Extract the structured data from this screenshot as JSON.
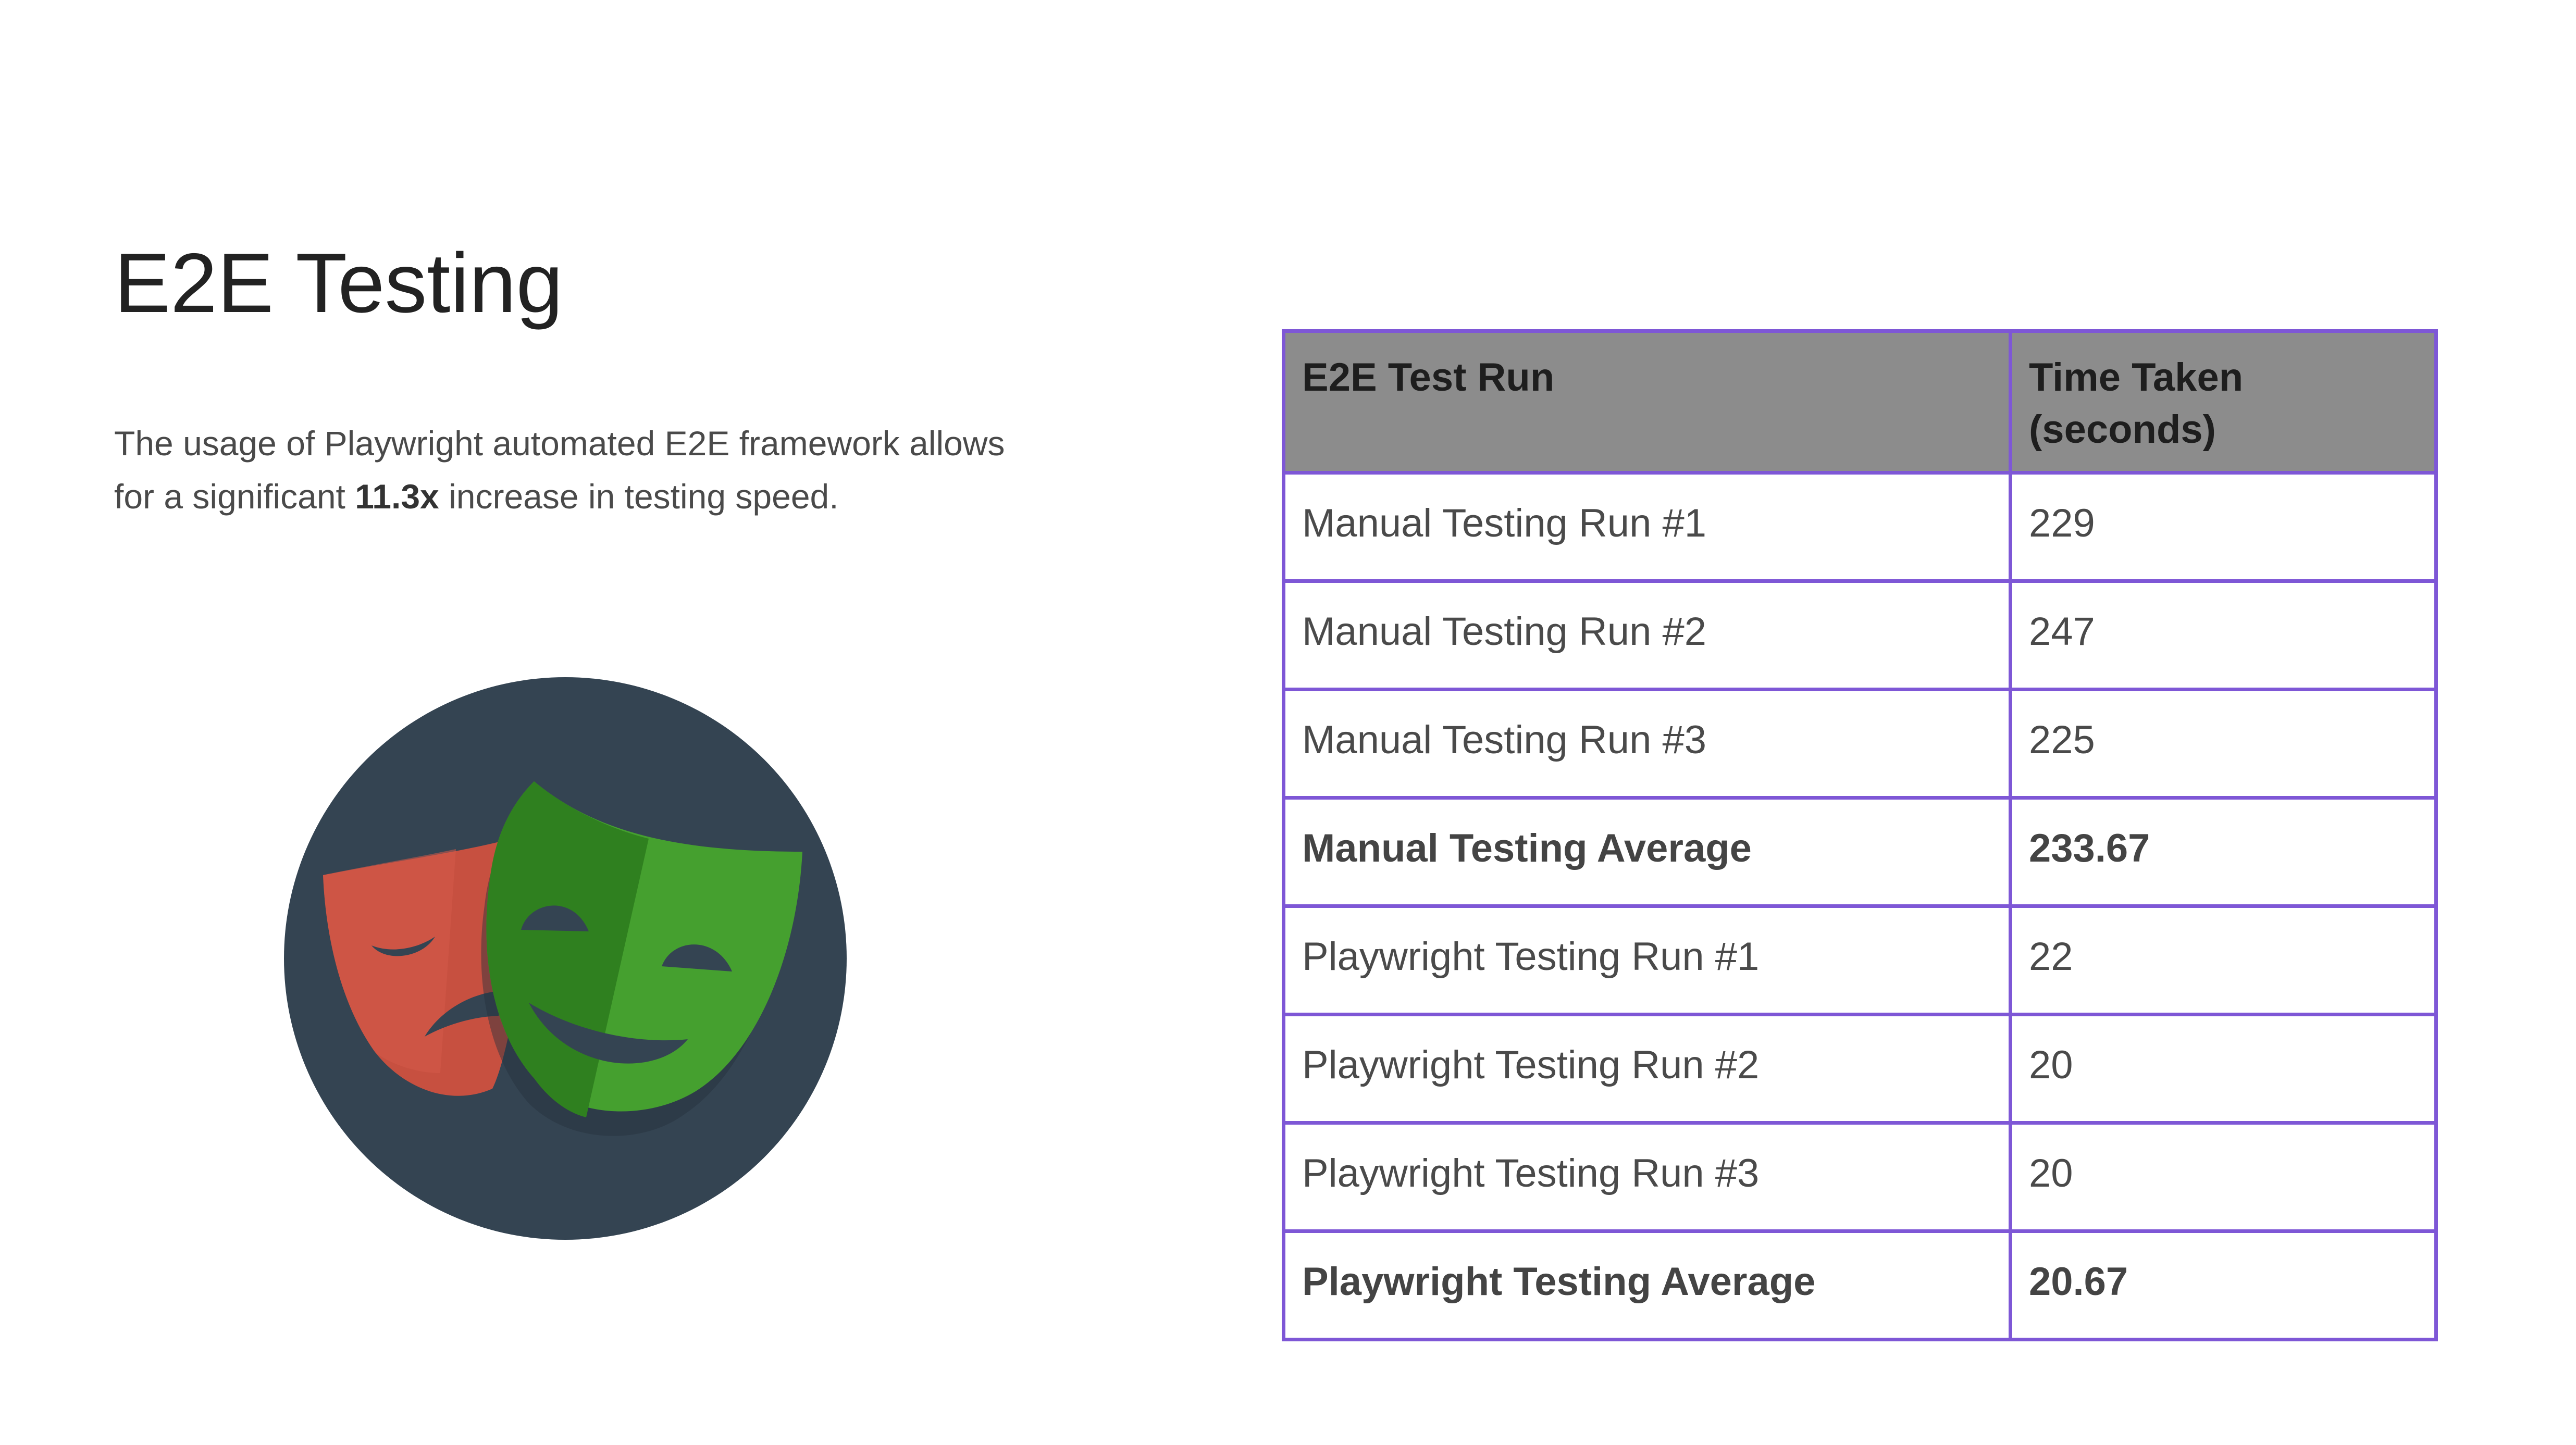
{
  "slide": {
    "title": "E2E Testing",
    "description": {
      "before": "The usage of Playwright automated E2E framework allows for a significant ",
      "highlight": "11.3x",
      "after": " increase in testing speed."
    }
  },
  "logo": {
    "icon": "playwright-masks-logo",
    "colors": {
      "background": "#344452",
      "red_mask": "#c75040",
      "green_mask": "#45a02f",
      "green_mask_shade": "#2f801f"
    }
  },
  "table": {
    "headers": [
      "E2E Test Run",
      "Time Taken (seconds)"
    ],
    "rows": [
      {
        "run": "Manual Testing Run #1",
        "time": "229",
        "bold": false
      },
      {
        "run": "Manual Testing Run #2",
        "time": "247",
        "bold": false
      },
      {
        "run": "Manual Testing Run #3",
        "time": "225",
        "bold": false
      },
      {
        "run": "Manual Testing Average",
        "time": "233.67",
        "bold": true
      },
      {
        "run": "Playwright Testing Run #1",
        "time": "22",
        "bold": false
      },
      {
        "run": "Playwright Testing Run #2",
        "time": "20",
        "bold": false
      },
      {
        "run": "Playwright Testing Run #3",
        "time": "20",
        "bold": false
      },
      {
        "run": "Playwright Testing Average",
        "time": "20.67",
        "bold": true
      }
    ],
    "colors": {
      "border": "#7e57d6",
      "header_bg": "#8c8c8c"
    }
  }
}
